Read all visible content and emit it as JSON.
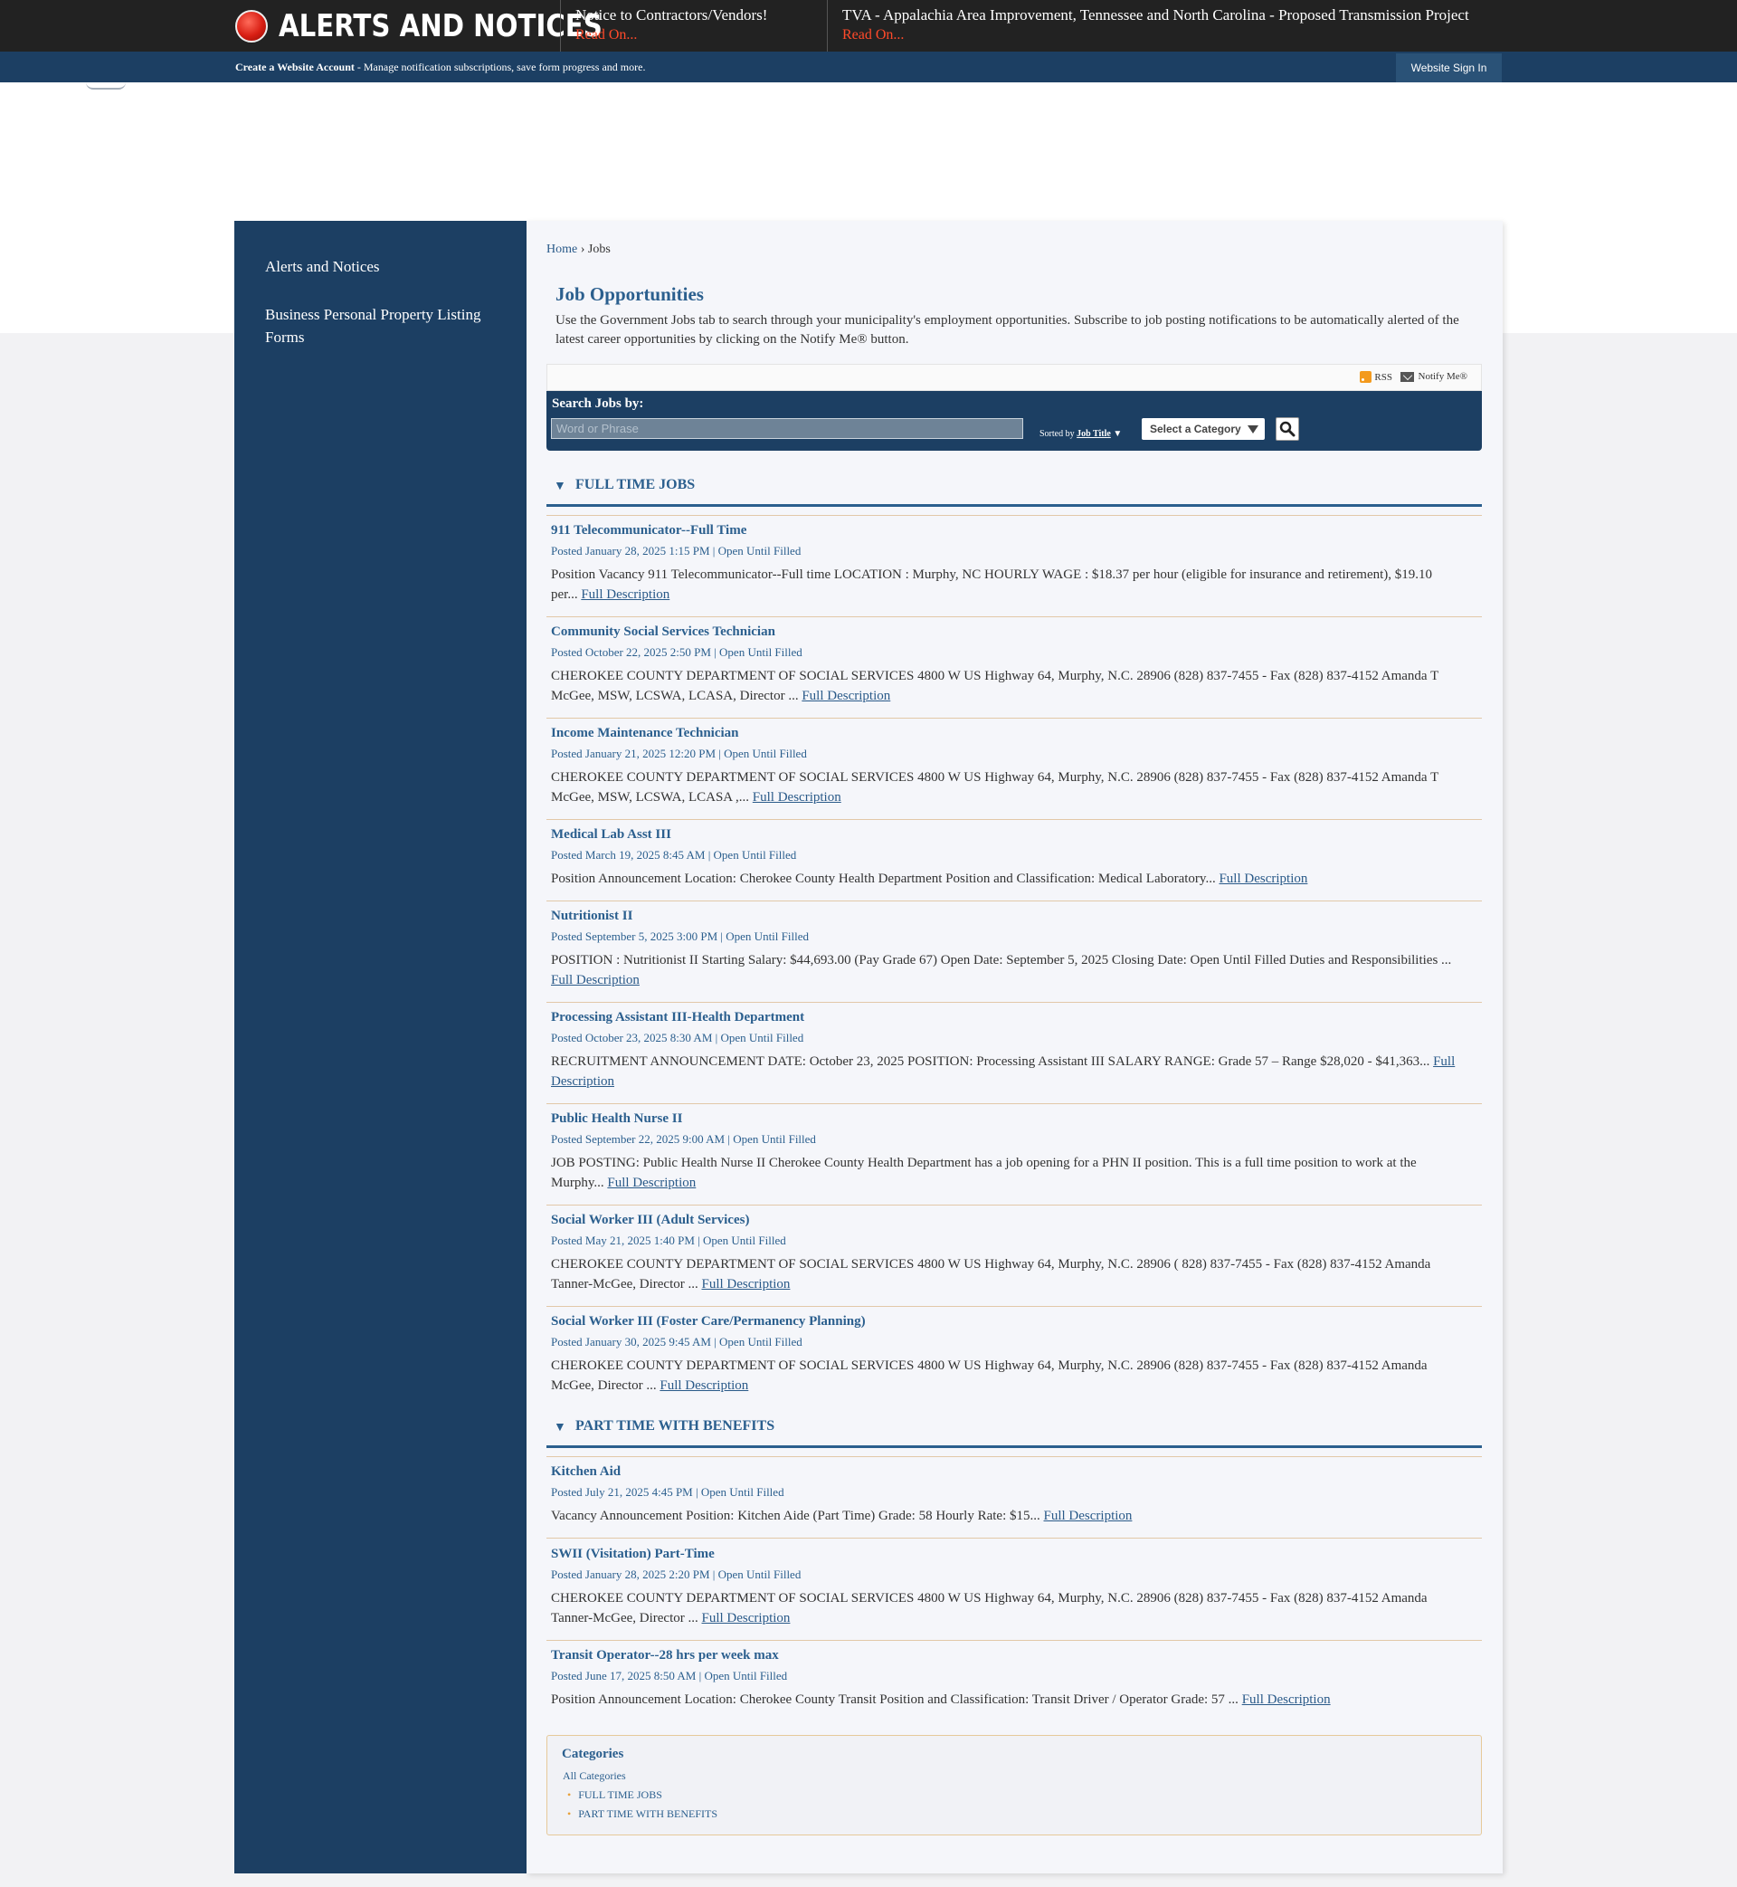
{
  "alerts": {
    "title": "ALERTS AND NOTICES",
    "items": [
      {
        "title": "Notice to Contractors/Vendors!",
        "link": "Read On..."
      },
      {
        "title": "TVA - Appalachia Area Improvement, Tennessee and North Carolina - Proposed Transmission Project",
        "link": "Read On..."
      }
    ]
  },
  "account_bar": {
    "create_label": "Create a Website Account",
    "create_desc": " - Manage notification subscriptions, save form progress and more.",
    "signin_label": "Website Sign In"
  },
  "sidebar": {
    "items": [
      {
        "label": "Alerts and Notices"
      },
      {
        "label": "Business Personal Property Listing Forms"
      }
    ]
  },
  "breadcrumb": {
    "home": "Home",
    "separator": "›",
    "current": "Jobs"
  },
  "page": {
    "title": "Job Opportunities",
    "intro": "Use the Government Jobs tab to search through your municipality's employment opportunities. Subscribe to job posting notifications to be automatically alerted of the latest career opportunities by clicking on the Notify Me® button."
  },
  "feeds": {
    "rss": "RSS",
    "notify": "Notify Me®"
  },
  "search": {
    "label": "Search Jobs by:",
    "placeholder": "Word or Phrase",
    "sorted_by_prefix": "Sorted by",
    "sorted_by_value": "Job Title",
    "sort_arrow": "▼",
    "category_select": "Select a Category"
  },
  "link_text": "Full Description",
  "categories": [
    {
      "toggle": "▼",
      "name": "FULL TIME JOBS",
      "jobs": [
        {
          "title": "911 Telecommunicator--Full Time",
          "meta": "Posted January 28, 2025 1:15 PM | Open Until Filled",
          "desc": "Position Vacancy 911 Telecommunicator--Full time LOCATION : Murphy, NC HOURLY WAGE : $18.37 per hour (eligible for insurance and retirement), $19.10 per... "
        },
        {
          "title": "Community Social Services Technician",
          "meta": "Posted October 22, 2025 2:50 PM | Open Until Filled",
          "desc": "CHEROKEE COUNTY DEPARTMENT OF SOCIAL SERVICES 4800 W US Highway 64, Murphy, N.C. 28906 (828) 837-7455 - Fax (828) 837-4152 Amanda T McGee, MSW, LCSWA, LCASA, Director ... "
        },
        {
          "title": "Income Maintenance Technician",
          "meta": "Posted January 21, 2025 12:20 PM | Open Until Filled",
          "desc": "CHEROKEE COUNTY DEPARTMENT OF SOCIAL SERVICES 4800 W US Highway 64, Murphy, N.C. 28906 (828) 837-7455 - Fax (828) 837-4152 Amanda T McGee, MSW, LCSWA, LCASA ,... "
        },
        {
          "title": "Medical Lab Asst III",
          "meta": "Posted March 19, 2025 8:45 AM | Open Until Filled",
          "desc": "Position Announcement Location: Cherokee County Health Department Position and Classification: Medical Laboratory... "
        },
        {
          "title": "Nutritionist II",
          "meta": "Posted September 5, 2025 3:00 PM | Open Until Filled",
          "desc": "POSITION : Nutritionist II Starting Salary: $44,693.00 (Pay Grade 67) Open Date: September 5, 2025 Closing Date: Open Until Filled Duties and Responsibilities ... "
        },
        {
          "title": "Processing Assistant III-Health Department",
          "meta": "Posted October 23, 2025 8:30 AM | Open Until Filled",
          "desc": "RECRUITMENT ANNOUNCEMENT DATE: October 23, 2025 POSITION: Processing Assistant III SALARY RANGE: Grade 57 – Range $28,020 - $41,363... "
        },
        {
          "title": "Public Health Nurse II",
          "meta": "Posted September 22, 2025 9:00 AM | Open Until Filled",
          "desc": "JOB POSTING: Public Health Nurse II Cherokee County Health Department has a job opening for a PHN II position. This is a full time position to work at the Murphy... "
        },
        {
          "title": "Social Worker III (Adult Services)",
          "meta": "Posted May 21, 2025 1:40 PM | Open Until Filled",
          "desc": "CHEROKEE COUNTY DEPARTMENT OF SOCIAL SERVICES 4800 W US Highway 64, Murphy, N.C. 28906 ( 828) 837-7455 - Fax (828) 837-4152 Amanda Tanner-McGee, Director ... "
        },
        {
          "title": "Social Worker III (Foster Care/Permanency Planning)",
          "meta": "Posted January 30, 2025 9:45 AM | Open Until Filled",
          "desc": "CHEROKEE COUNTY DEPARTMENT OF SOCIAL SERVICES 4800 W US Highway 64, Murphy, N.C. 28906 (828) 837-7455 - Fax (828) 837-4152 Amanda McGee, Director ... "
        }
      ]
    },
    {
      "toggle": "▼",
      "name": "PART TIME WITH BENEFITS",
      "jobs": [
        {
          "title": "Kitchen Aid",
          "meta": "Posted July 21, 2025 4:45 PM | Open Until Filled",
          "desc": "Vacancy Announcement Position: Kitchen Aide (Part Time) Grade: 58 Hourly Rate: $15... "
        },
        {
          "title": "SWII (Visitation) Part-Time",
          "meta": "Posted January 28, 2025 2:20 PM | Open Until Filled",
          "desc": "CHEROKEE COUNTY DEPARTMENT OF SOCIAL SERVICES 4800 W US Highway 64, Murphy, N.C. 28906 (828) 837-7455 - Fax (828) 837-4152 Amanda Tanner-McGee, Director ... "
        },
        {
          "title": "Transit Operator--28 hrs per week max",
          "meta": "Posted June 17, 2025 8:50 AM | Open Until Filled",
          "desc": "Position Announcement Location: Cherokee County Transit Position and Classification: Transit Driver / Operator Grade: 57 ... "
        }
      ]
    }
  ],
  "category_box": {
    "title": "Categories",
    "all": "All Categories",
    "items": [
      "FULL TIME JOBS",
      "PART TIME WITH BENEFITS"
    ]
  }
}
